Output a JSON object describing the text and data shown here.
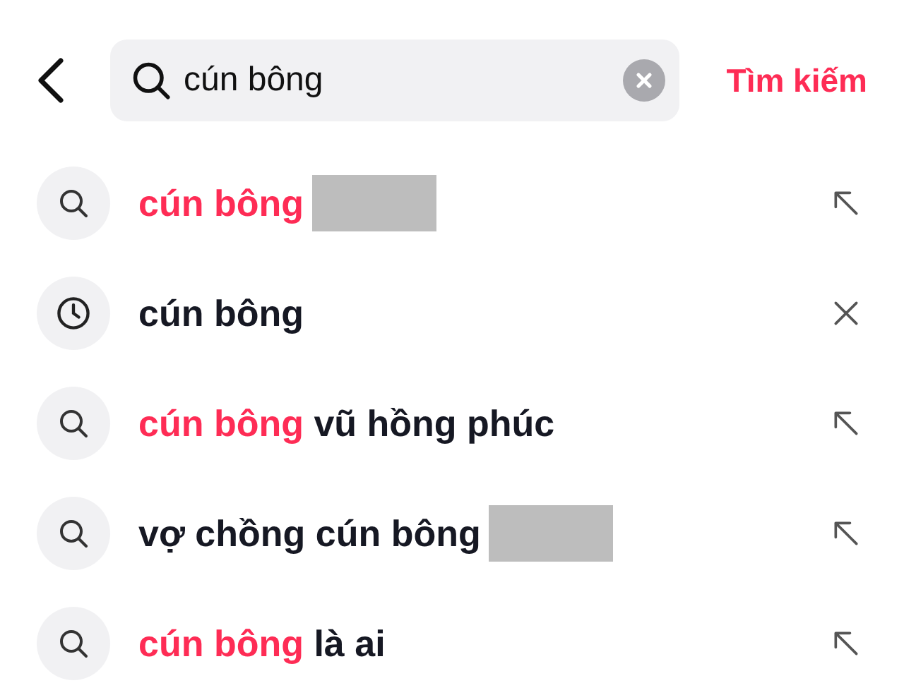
{
  "search": {
    "value": "cún bông",
    "action": "Tìm kiếm"
  },
  "suggestions": [
    {
      "kind": "suggestion",
      "parts": [
        {
          "text": "cún bông",
          "highlight": true
        }
      ],
      "redacted": true
    },
    {
      "kind": "history",
      "parts": [
        {
          "text": "cún bông",
          "highlight": false
        }
      ],
      "redacted": false
    },
    {
      "kind": "suggestion",
      "parts": [
        {
          "text": "cún bông",
          "highlight": true
        },
        {
          "text": " vũ hồng phúc",
          "highlight": false
        }
      ],
      "redacted": false
    },
    {
      "kind": "suggestion",
      "parts": [
        {
          "text": "vợ chồng cún bông",
          "highlight": false
        }
      ],
      "redacted": true
    },
    {
      "kind": "suggestion",
      "parts": [
        {
          "text": "cún bông",
          "highlight": true
        },
        {
          "text": " là ai",
          "highlight": false
        }
      ],
      "redacted": false
    }
  ]
}
